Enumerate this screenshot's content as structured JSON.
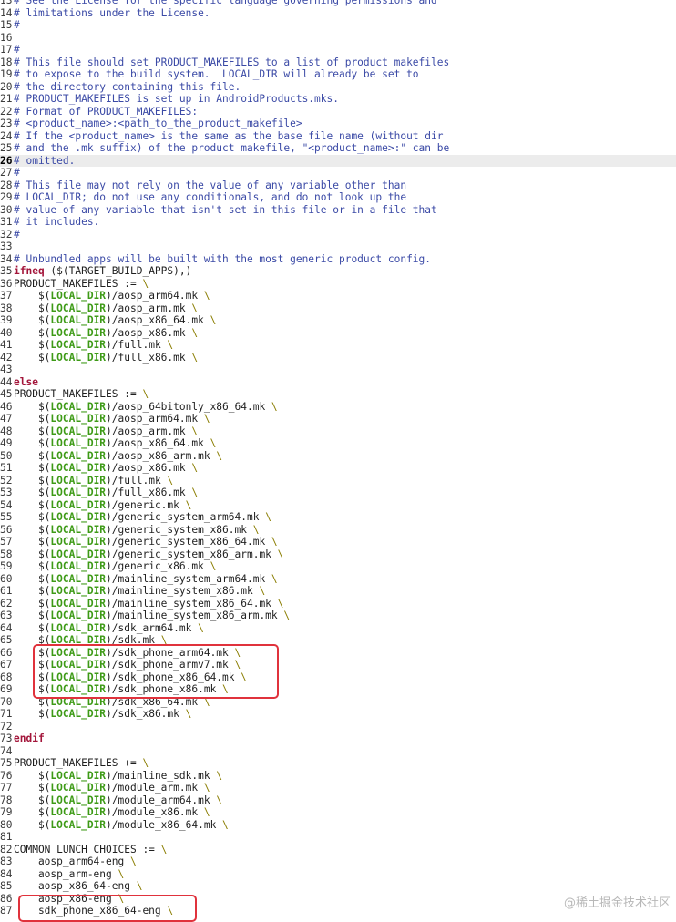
{
  "editor": {
    "cursor_line": "26",
    "lines": [
      {
        "n": "13",
        "t": "c",
        "text": "# See the License for the specific language governing permissions and"
      },
      {
        "n": "14",
        "t": "c",
        "text": "# limitations under the License."
      },
      {
        "n": "15",
        "t": "c",
        "text": "#"
      },
      {
        "n": "16",
        "t": "p",
        "text": ""
      },
      {
        "n": "17",
        "t": "c",
        "text": "#"
      },
      {
        "n": "18",
        "t": "c",
        "text": "# This file should set PRODUCT_MAKEFILES to a list of product makefiles"
      },
      {
        "n": "19",
        "t": "c",
        "text": "# to expose to the build system.  LOCAL_DIR will already be set to"
      },
      {
        "n": "20",
        "t": "c",
        "text": "# the directory containing this file."
      },
      {
        "n": "21",
        "t": "c",
        "text": "# PRODUCT_MAKEFILES is set up in AndroidProducts.mks."
      },
      {
        "n": "22",
        "t": "c",
        "text": "# Format of PRODUCT_MAKEFILES:"
      },
      {
        "n": "23",
        "t": "c",
        "text": "# <product_name>:<path_to_the_product_makefile>"
      },
      {
        "n": "24",
        "t": "c",
        "text": "# If the <product_name> is the same as the base file name (without dir"
      },
      {
        "n": "25",
        "t": "c",
        "text": "# and the .mk suffix) of the product makefile, \"<product_name>:\" can be"
      },
      {
        "n": "26",
        "t": "c",
        "text": "# omitted."
      },
      {
        "n": "27",
        "t": "c",
        "text": "#"
      },
      {
        "n": "28",
        "t": "c",
        "text": "# This file may not rely on the value of any variable other than"
      },
      {
        "n": "29",
        "t": "c",
        "text": "# LOCAL_DIR; do not use any conditionals, and do not look up the"
      },
      {
        "n": "30",
        "t": "c",
        "text": "# value of any variable that isn't set in this file or in a file that"
      },
      {
        "n": "31",
        "t": "c",
        "text": "# it includes."
      },
      {
        "n": "32",
        "t": "c",
        "text": "#"
      },
      {
        "n": "33",
        "t": "p",
        "text": ""
      },
      {
        "n": "34",
        "t": "c",
        "text": "# Unbundled apps will be built with the most generic product config."
      },
      {
        "n": "35",
        "t": "k",
        "kw": "ifneq",
        "text": " ($(TARGET_BUILD_APPS),)"
      },
      {
        "n": "36",
        "t": "a",
        "text": "PRODUCT_MAKEFILES := ",
        "bs": "\\"
      },
      {
        "n": "37",
        "t": "m",
        "path": "/aosp_arm64.mk ",
        "bs": "\\"
      },
      {
        "n": "38",
        "t": "m",
        "path": "/aosp_arm.mk ",
        "bs": "\\"
      },
      {
        "n": "39",
        "t": "m",
        "path": "/aosp_x86_64.mk ",
        "bs": "\\"
      },
      {
        "n": "40",
        "t": "m",
        "path": "/aosp_x86.mk ",
        "bs": "\\"
      },
      {
        "n": "41",
        "t": "m",
        "path": "/full.mk ",
        "bs": "\\"
      },
      {
        "n": "42",
        "t": "m",
        "path": "/full_x86.mk ",
        "bs": "\\"
      },
      {
        "n": "43",
        "t": "p",
        "text": ""
      },
      {
        "n": "44",
        "t": "k",
        "kw": "else",
        "text": ""
      },
      {
        "n": "45",
        "t": "a",
        "text": "PRODUCT_MAKEFILES := ",
        "bs": "\\"
      },
      {
        "n": "46",
        "t": "m",
        "path": "/aosp_64bitonly_x86_64.mk ",
        "bs": "\\"
      },
      {
        "n": "47",
        "t": "m",
        "path": "/aosp_arm64.mk ",
        "bs": "\\"
      },
      {
        "n": "48",
        "t": "m",
        "path": "/aosp_arm.mk ",
        "bs": "\\"
      },
      {
        "n": "49",
        "t": "m",
        "path": "/aosp_x86_64.mk ",
        "bs": "\\"
      },
      {
        "n": "50",
        "t": "m",
        "path": "/aosp_x86_arm.mk ",
        "bs": "\\"
      },
      {
        "n": "51",
        "t": "m",
        "path": "/aosp_x86.mk ",
        "bs": "\\"
      },
      {
        "n": "52",
        "t": "m",
        "path": "/full.mk ",
        "bs": "\\"
      },
      {
        "n": "53",
        "t": "m",
        "path": "/full_x86.mk ",
        "bs": "\\"
      },
      {
        "n": "54",
        "t": "m",
        "path": "/generic.mk ",
        "bs": "\\"
      },
      {
        "n": "55",
        "t": "m",
        "path": "/generic_system_arm64.mk ",
        "bs": "\\"
      },
      {
        "n": "56",
        "t": "m",
        "path": "/generic_system_x86.mk ",
        "bs": "\\"
      },
      {
        "n": "57",
        "t": "m",
        "path": "/generic_system_x86_64.mk ",
        "bs": "\\"
      },
      {
        "n": "58",
        "t": "m",
        "path": "/generic_system_x86_arm.mk ",
        "bs": "\\"
      },
      {
        "n": "59",
        "t": "m",
        "path": "/generic_x86.mk ",
        "bs": "\\"
      },
      {
        "n": "60",
        "t": "m",
        "path": "/mainline_system_arm64.mk ",
        "bs": "\\"
      },
      {
        "n": "61",
        "t": "m",
        "path": "/mainline_system_x86.mk ",
        "bs": "\\"
      },
      {
        "n": "62",
        "t": "m",
        "path": "/mainline_system_x86_64.mk ",
        "bs": "\\"
      },
      {
        "n": "63",
        "t": "m",
        "path": "/mainline_system_x86_arm.mk ",
        "bs": "\\"
      },
      {
        "n": "64",
        "t": "m",
        "path": "/sdk_arm64.mk ",
        "bs": "\\"
      },
      {
        "n": "65",
        "t": "m",
        "path": "/sdk.mk ",
        "bs": "\\"
      },
      {
        "n": "66",
        "t": "m",
        "path": "/sdk_phone_arm64.mk ",
        "bs": "\\"
      },
      {
        "n": "67",
        "t": "m",
        "path": "/sdk_phone_armv7.mk ",
        "bs": "\\"
      },
      {
        "n": "68",
        "t": "m",
        "path": "/sdk_phone_x86_64.mk ",
        "bs": "\\"
      },
      {
        "n": "69",
        "t": "m",
        "path": "/sdk_phone_x86.mk ",
        "bs": "\\"
      },
      {
        "n": "70",
        "t": "m",
        "path": "/sdk_x86_64.mk ",
        "bs": "\\"
      },
      {
        "n": "71",
        "t": "m",
        "path": "/sdk_x86.mk ",
        "bs": "\\"
      },
      {
        "n": "72",
        "t": "p",
        "text": ""
      },
      {
        "n": "73",
        "t": "k",
        "kw": "endif",
        "text": ""
      },
      {
        "n": "74",
        "t": "p",
        "text": ""
      },
      {
        "n": "75",
        "t": "a",
        "text": "PRODUCT_MAKEFILES += ",
        "bs": "\\"
      },
      {
        "n": "76",
        "t": "m",
        "path": "/mainline_sdk.mk ",
        "bs": "\\"
      },
      {
        "n": "77",
        "t": "m",
        "path": "/module_arm.mk ",
        "bs": "\\"
      },
      {
        "n": "78",
        "t": "m",
        "path": "/module_arm64.mk ",
        "bs": "\\"
      },
      {
        "n": "79",
        "t": "m",
        "path": "/module_x86.mk ",
        "bs": "\\"
      },
      {
        "n": "80",
        "t": "m",
        "path": "/module_x86_64.mk ",
        "bs": "\\"
      },
      {
        "n": "81",
        "t": "p",
        "text": ""
      },
      {
        "n": "82",
        "t": "a",
        "text": "COMMON_LUNCH_CHOICES := ",
        "bs": "\\"
      },
      {
        "n": "83",
        "t": "a",
        "text": "    aosp_arm64-eng ",
        "bs": "\\"
      },
      {
        "n": "84",
        "t": "a",
        "text": "    aosp_arm-eng ",
        "bs": "\\"
      },
      {
        "n": "85",
        "t": "a",
        "text": "    aosp_x86_64-eng ",
        "bs": "\\"
      },
      {
        "n": "86",
        "t": "a",
        "text": "    aosp_x86-eng ",
        "bs": "\\"
      },
      {
        "n": "87",
        "t": "a",
        "text": "    sdk_phone_x86_64-eng ",
        "bs": "\\"
      }
    ],
    "var_prefix": "    $(",
    "var_name": "LOCAL_DIR",
    "var_suffix": ")"
  },
  "watermark": "@稀土掘金技术社区",
  "colors": {
    "comment": "#3b4aa6",
    "keyword": "#a3153a",
    "variable": "#3d9a16",
    "backslash": "#8a7d00",
    "highlight_box": "#e0323c"
  }
}
